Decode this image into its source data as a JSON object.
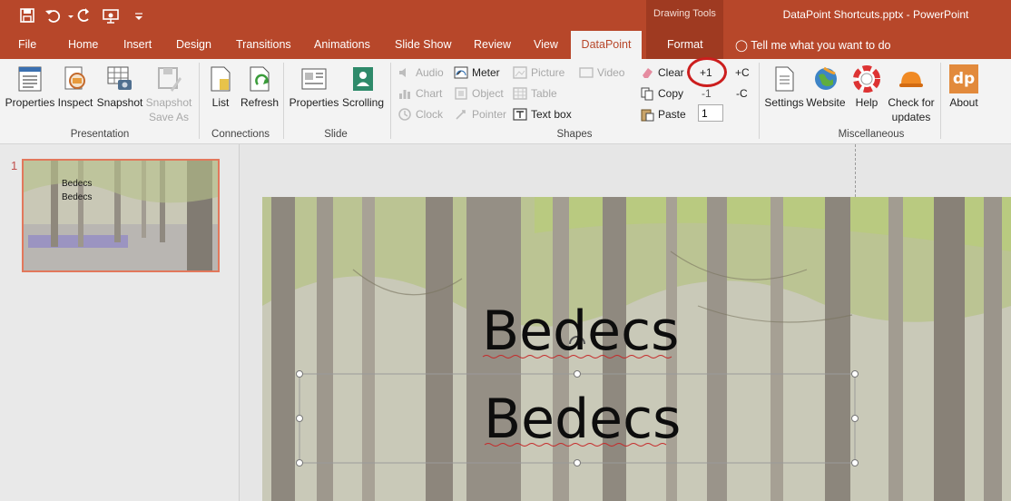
{
  "window": {
    "title": "DataPoint Shortcuts.pptx - PowerPoint",
    "contextual_group": "Drawing Tools",
    "quick_access": [
      "save-icon",
      "undo-icon",
      "redo-icon",
      "present-icon",
      "customize-icon"
    ]
  },
  "tabs": [
    "File",
    "Home",
    "Insert",
    "Design",
    "Transitions",
    "Animations",
    "Slide Show",
    "Review",
    "View",
    "DataPoint",
    "Format"
  ],
  "active_tab": "DataPoint",
  "tell_me": "Tell me what you want to do",
  "ribbon": {
    "presentation": {
      "label": "Presentation",
      "properties": "Properties",
      "inspect": "Inspect",
      "snapshot": "Snapshot",
      "snapshot_save_as_1": "Snapshot",
      "snapshot_save_as_2": "Save As"
    },
    "connections": {
      "label": "Connections",
      "list": "List",
      "refresh": "Refresh"
    },
    "slide": {
      "label": "Slide",
      "properties": "Properties",
      "scrolling": "Scrolling"
    },
    "shapes": {
      "label": "Shapes",
      "audio": "Audio",
      "chart": "Chart",
      "clock": "Clock",
      "meter": "Meter",
      "object": "Object",
      "pointer": "Pointer",
      "picture": "Picture",
      "table": "Table",
      "text_box": "Text box",
      "video": "Video",
      "clear": "Clear",
      "copy": "Copy",
      "paste": "Paste",
      "plus_one": "+1",
      "minus_one": "-1",
      "plus_c": "+C",
      "minus_c": "-C",
      "step_value": "1"
    },
    "misc": {
      "label": "Miscellaneous",
      "settings": "Settings",
      "website": "Website",
      "help": "Help",
      "check_1": "Check for",
      "check_2": "updates",
      "about": "About",
      "about_logo": "dp"
    }
  },
  "thumbnail": {
    "number": "1",
    "line1": "Bedecs",
    "line2": "Bedecs"
  },
  "slide": {
    "text1": "Bedecs",
    "text2": "Bedecs"
  },
  "colors": {
    "accent": "#b7472a",
    "annotation": "#cc1e1e"
  }
}
